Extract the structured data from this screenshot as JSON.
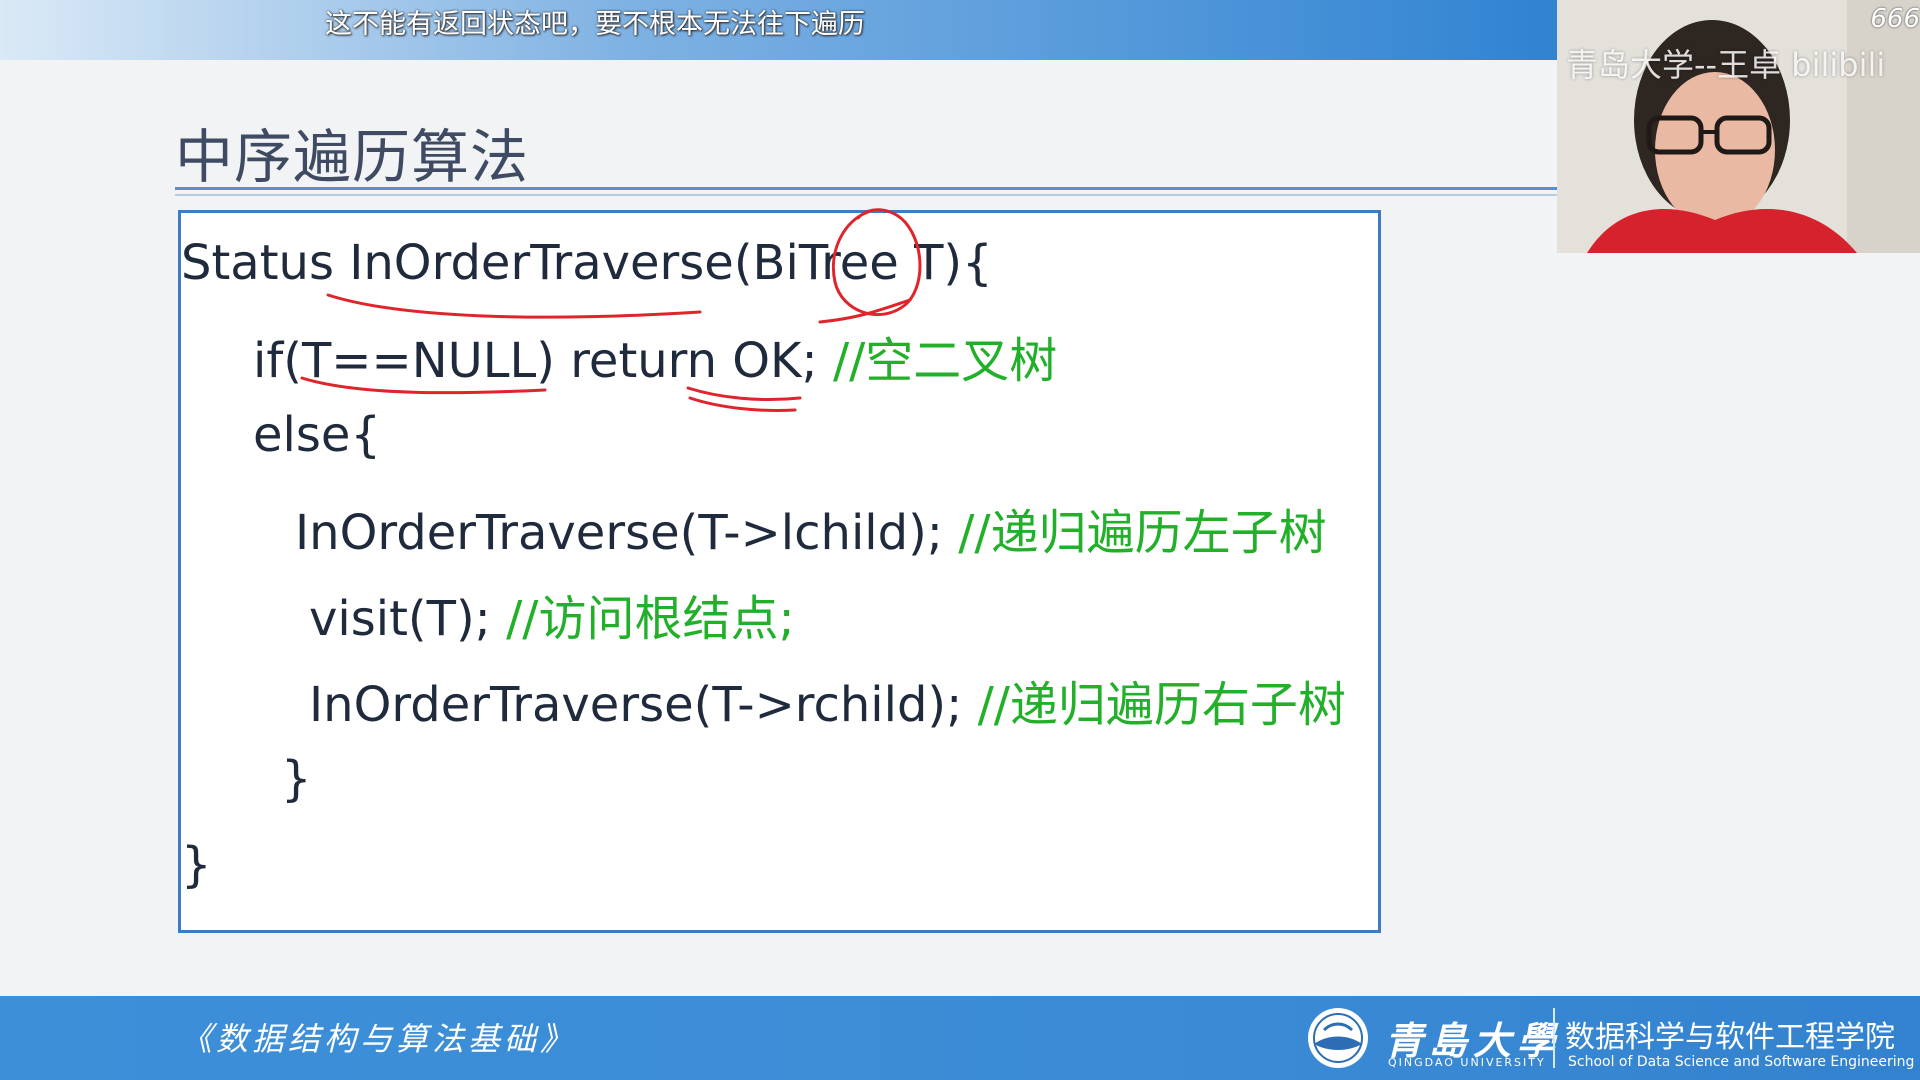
{
  "top_bar": {
    "danmaku": "这不能有返回状态吧，要不根本无法往下遍历",
    "count": "666"
  },
  "slide": {
    "title": "中序遍历算法",
    "code_lines": [
      {
        "code": "Status InOrderTraverse(BiTree T){",
        "comment": ""
      },
      {
        "code": "if(T==NULL) return OK; ",
        "comment": "//空二叉树"
      },
      {
        "code": "else{",
        "comment": ""
      },
      {
        "code": "InOrderTraverse(T->lchild); ",
        "comment": "//递归遍历左子树"
      },
      {
        "code": "visit(T);  ",
        "comment": "//访问根结点;"
      },
      {
        "code": "InOrderTraverse(T->rchild); ",
        "comment": "//递归遍历右子树"
      },
      {
        "code": "}",
        "comment": ""
      },
      {
        "code": "}",
        "comment": ""
      }
    ]
  },
  "webcam": {
    "watermark": "青岛大学--王卓 bilibili"
  },
  "footer": {
    "course_title": "《数据结构与算法基础》",
    "university_name": "青島大學",
    "university_name_en": "QINGDAO UNIVERSITY",
    "school_name": "数据科学与软件工程学院",
    "school_name_en": "School of Data Science and Software Engineering"
  },
  "colors": {
    "code_text": "#1f2a3c",
    "comment": "#22b02a",
    "annotation_ink": "#e0242b",
    "accent": "#3b8bd6"
  }
}
